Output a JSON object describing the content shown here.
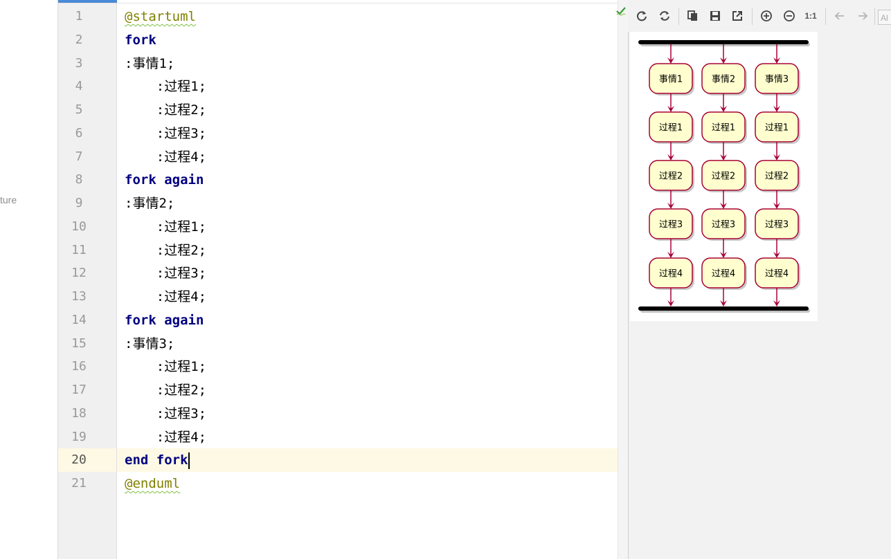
{
  "left_panel": {
    "label": "ture"
  },
  "editor": {
    "line_numbers": [
      "1",
      "2",
      "3",
      "4",
      "5",
      "6",
      "7",
      "8",
      "9",
      "10",
      "11",
      "12",
      "13",
      "14",
      "15",
      "16",
      "17",
      "18",
      "19",
      "20",
      "21"
    ],
    "lines": [
      {
        "indent": "",
        "keyword": "",
        "directive": "@startuml",
        "text": ""
      },
      {
        "indent": "",
        "keyword": "fork",
        "directive": "",
        "text": ""
      },
      {
        "indent": "",
        "keyword": "",
        "directive": "",
        "text": ":事情1;"
      },
      {
        "indent": "    ",
        "keyword": "",
        "directive": "",
        "text": ":过程1;"
      },
      {
        "indent": "    ",
        "keyword": "",
        "directive": "",
        "text": ":过程2;"
      },
      {
        "indent": "    ",
        "keyword": "",
        "directive": "",
        "text": ":过程3;"
      },
      {
        "indent": "    ",
        "keyword": "",
        "directive": "",
        "text": ":过程4;"
      },
      {
        "indent": "",
        "keyword": "fork again",
        "directive": "",
        "text": ""
      },
      {
        "indent": "",
        "keyword": "",
        "directive": "",
        "text": ":事情2;"
      },
      {
        "indent": "    ",
        "keyword": "",
        "directive": "",
        "text": ":过程1;"
      },
      {
        "indent": "    ",
        "keyword": "",
        "directive": "",
        "text": ":过程2;"
      },
      {
        "indent": "    ",
        "keyword": "",
        "directive": "",
        "text": ":过程3;"
      },
      {
        "indent": "    ",
        "keyword": "",
        "directive": "",
        "text": ":过程4;"
      },
      {
        "indent": "",
        "keyword": "fork again",
        "directive": "",
        "text": ""
      },
      {
        "indent": "",
        "keyword": "",
        "directive": "",
        "text": ":事情3;"
      },
      {
        "indent": "    ",
        "keyword": "",
        "directive": "",
        "text": ":过程1;"
      },
      {
        "indent": "    ",
        "keyword": "",
        "directive": "",
        "text": ":过程2;"
      },
      {
        "indent": "    ",
        "keyword": "",
        "directive": "",
        "text": ":过程3;"
      },
      {
        "indent": "    ",
        "keyword": "",
        "directive": "",
        "text": ":过程4;"
      },
      {
        "indent": "",
        "keyword": "end fork",
        "directive": "",
        "text": ""
      },
      {
        "indent": "",
        "keyword": "",
        "directive": "@enduml",
        "text": ""
      }
    ],
    "current_line": 20,
    "colors": {
      "keyword": "#000080",
      "directive": "#808000",
      "current_line_bg": "#fdf9e4"
    }
  },
  "preview_toolbar": {
    "buttons": [
      {
        "name": "refresh-icon"
      },
      {
        "name": "sync-icon"
      },
      {
        "name": "copy-icon"
      },
      {
        "name": "save-icon"
      },
      {
        "name": "open-external-icon"
      },
      {
        "name": "zoom-in-icon"
      },
      {
        "name": "zoom-out-icon"
      },
      {
        "name": "actual-size-button",
        "label": "1:1"
      },
      {
        "name": "back-arrow-icon"
      },
      {
        "name": "forward-arrow-icon"
      }
    ],
    "search_text": "Al"
  },
  "diagram": {
    "columns": [
      {
        "nodes": [
          "事情1",
          "过程1",
          "过程2",
          "过程3",
          "过程4"
        ]
      },
      {
        "nodes": [
          "事情2",
          "过程1",
          "过程2",
          "过程3",
          "过程4"
        ]
      },
      {
        "nodes": [
          "事情3",
          "过程1",
          "过程2",
          "过程3",
          "过程4"
        ]
      }
    ],
    "colors": {
      "node_fill": "#fefece",
      "node_border": "#a80036",
      "arrow": "#a80036",
      "bar": "#000000"
    }
  }
}
